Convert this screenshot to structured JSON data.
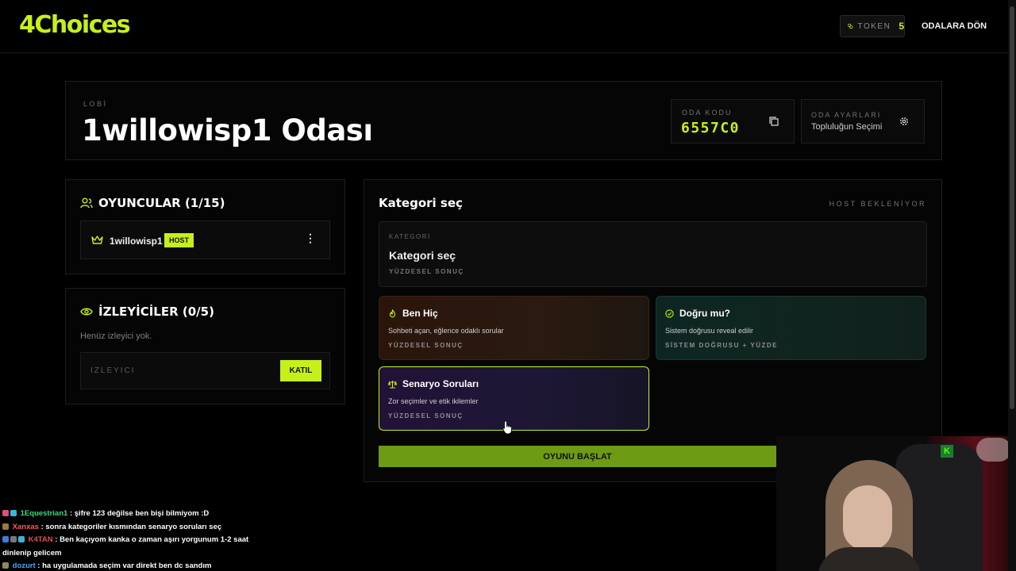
{
  "header": {
    "logo": "4Choices",
    "token_label": "TOKEN",
    "token_count": "5",
    "back_link": "ODALARA DÖN"
  },
  "lobby": {
    "label": "LOBİ",
    "room_title": "1willowisp1 Odası",
    "room_code_label": "ODA KODU",
    "room_code": "6557C0",
    "settings_label": "ODA AYARLARI",
    "settings_value": "Topluluğun Seçimi"
  },
  "players": {
    "title": "OYUNCULAR (1/15)",
    "list": [
      {
        "name": "1willowisp1",
        "badge": "HOST"
      }
    ]
  },
  "watchers": {
    "title": "İZLEYİCİLER (0/5)",
    "empty_text": "Henüz izleyici yok.",
    "input_placeholder": "İZLEYİCİ",
    "join_label": "KATIL"
  },
  "category": {
    "title": "Kategori seç",
    "status": "HOST BEKLENİYOR",
    "selected": {
      "label": "KATEGORİ",
      "value": "Kategori seç",
      "sub": "YÜZDESEL SONUÇ"
    },
    "options": [
      {
        "title": "Ben Hiç",
        "description": "Sohbeti açan, eğlence odaklı sorular",
        "tag": "YÜZDESEL SONUÇ",
        "icon": "flame-icon"
      },
      {
        "title": "Doğru mu?",
        "description": "Sistem doğrusu reveal edilir",
        "tag": "SİSTEM DOĞRUSU + YÜZDE",
        "icon": "check-circle-icon"
      },
      {
        "title": "Senaryo Soruları",
        "description": "Zor seçimler ve etik ikilemler",
        "tag": "YÜZDESEL SONUÇ",
        "icon": "scales-icon"
      }
    ],
    "start_label": "OYUNU BAŞLAT"
  },
  "chat": [
    {
      "user": "1Equestrian1",
      "text": "şifre 123 değilse ben bişi bilmiyom :D"
    },
    {
      "user": "Xanxas",
      "text": "sonra kategoriler kısmından senaryo soruları seç"
    },
    {
      "user": "K4TAN",
      "text": "Ben kaçıyom kanka o zaman aşırı yorgunum 1-2 saat dinlenip gelicem"
    },
    {
      "user": "dozurt",
      "text": "ha uygulamada seçim var direkt ben dc sandım"
    }
  ],
  "colors": {
    "accent": "#c6f01a",
    "start_button": "#6e9b14",
    "background": "#000000"
  }
}
